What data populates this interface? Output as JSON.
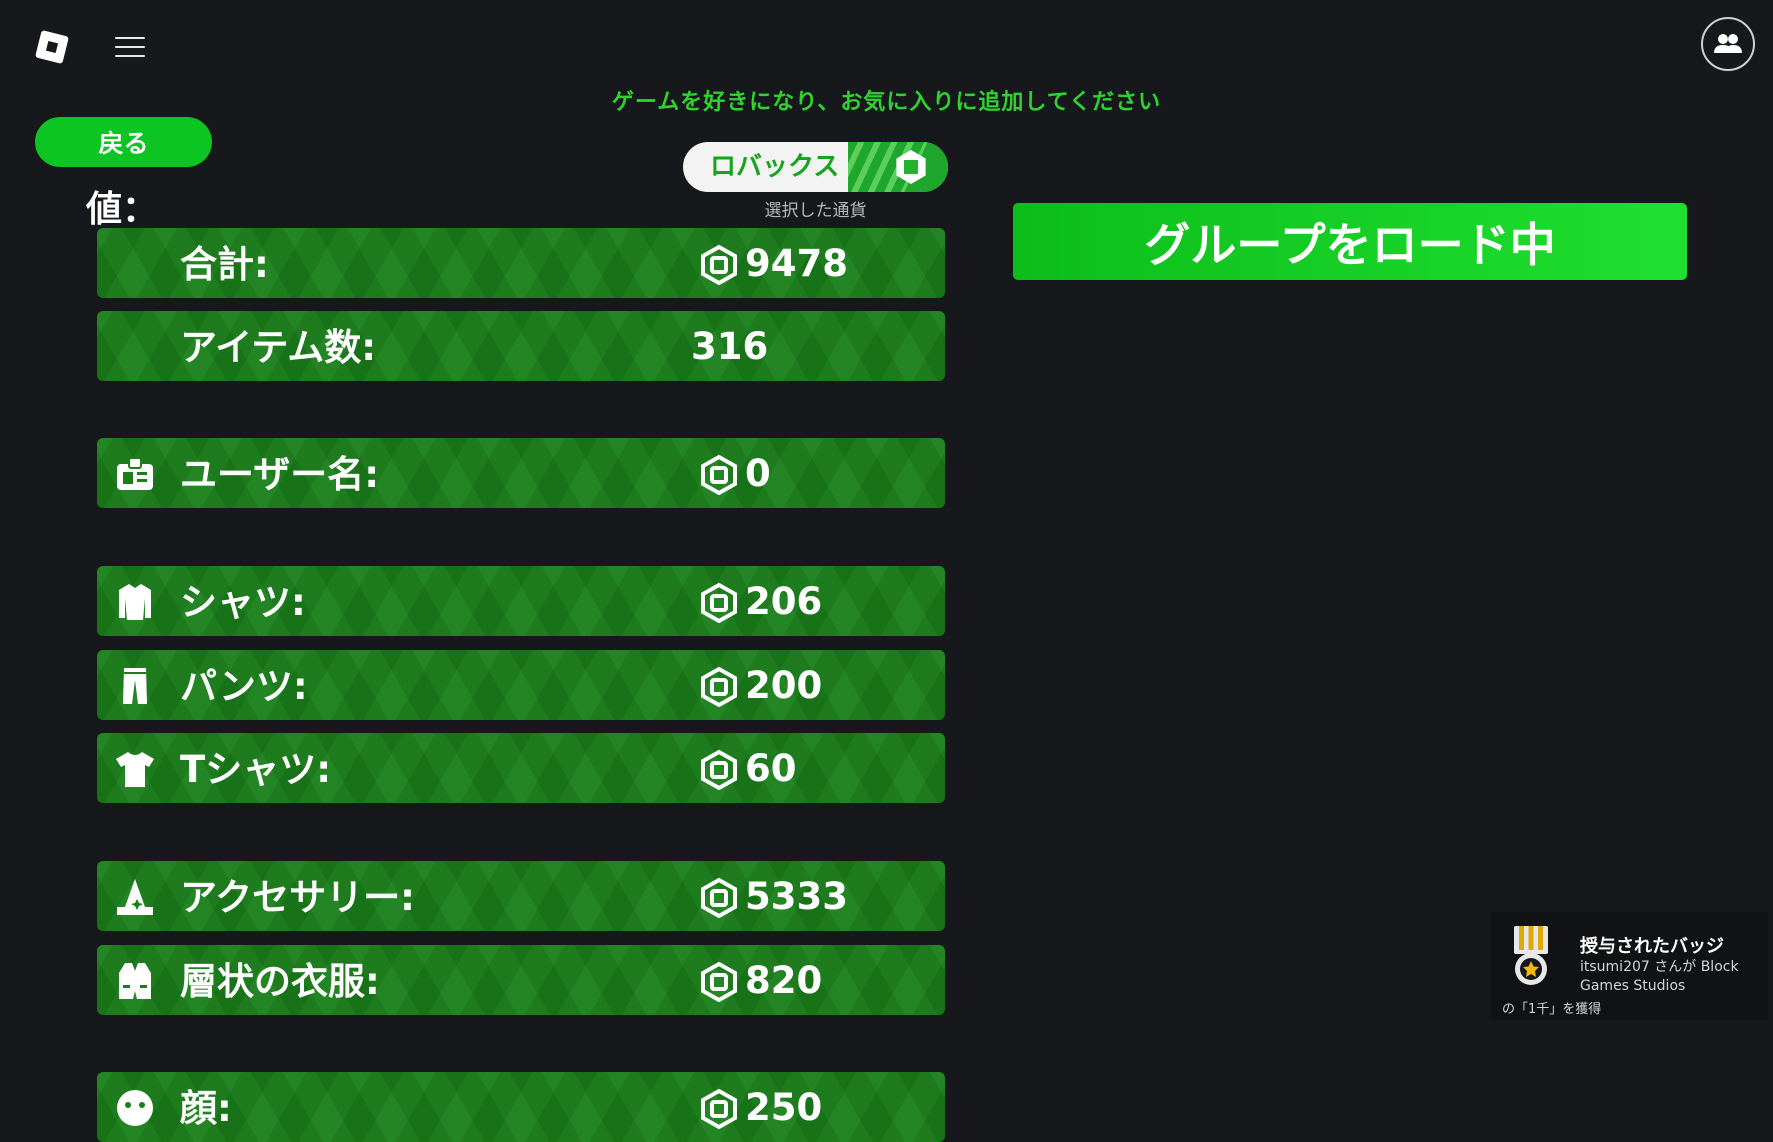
{
  "top_bar": {
    "logo": "roblox-logo",
    "menu_icon": "hamburger-menu-icon",
    "friends_icon": "friends-icon"
  },
  "banner": "ゲームを好きになり、お気に入りに追加してください",
  "back_button": "戻る",
  "value_title": "値：",
  "currency": {
    "label": "ロバックス",
    "sublabel": "選択した通貨",
    "icon": "robux-icon"
  },
  "loading_button": "グループをロード中",
  "rows": [
    {
      "label": "合計:",
      "value": "9478",
      "icon": null,
      "coin": true
    },
    {
      "label": "アイテム数:",
      "value": "316",
      "icon": null,
      "coin": false
    },
    {
      "label": "ユーザー名:",
      "value": "0",
      "icon": "id-badge-icon",
      "coin": true
    },
    {
      "label": "シャツ:",
      "value": "206",
      "icon": "shirt-icon",
      "coin": true
    },
    {
      "label": "パンツ:",
      "value": "200",
      "icon": "pants-icon",
      "coin": true
    },
    {
      "label": "Tシャツ:",
      "value": "60",
      "icon": "tshirt-icon",
      "coin": true
    },
    {
      "label": "アクセサリー:",
      "value": "5333",
      "icon": "hat-icon",
      "coin": true
    },
    {
      "label": "層状の衣服:",
      "value": "820",
      "icon": "vest-icon",
      "coin": true
    },
    {
      "label": "顔:",
      "value": "250",
      "icon": "face-icon",
      "coin": true
    }
  ],
  "toast": {
    "title": "授与されたバッジ",
    "body": "itsumi207 さんが Block Games Studios",
    "tail": "の「1千」を獲得",
    "icon": "medal-icon"
  },
  "colors": {
    "accent_green": "#0cc422",
    "row_green": "#1a7f1a",
    "banner_green": "#2fd32f",
    "background": "#16181c"
  }
}
